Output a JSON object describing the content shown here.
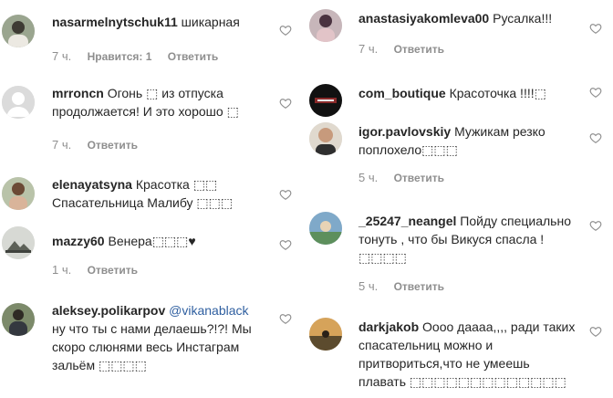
{
  "comments_left": [
    {
      "username": "nasarmelnytschuk11",
      "text": "шикарная",
      "time": "7 ч.",
      "likes": "Нравится: 1",
      "reply": "Ответить",
      "avatar_icon": "user-photo-avatar"
    },
    {
      "username": "mrroncn",
      "text": "Огонь ⬚ из отпуска продолжается! И это хорошо ⬚",
      "time": "7 ч.",
      "reply": "Ответить",
      "avatar_icon": "default-avatar-icon"
    },
    {
      "username": "elenayatsyna",
      "text": "Красотка ⬚⬚ Спасательница Малибу ⬚⬚⬚",
      "avatar_icon": "user-photo-avatar"
    },
    {
      "username": "mazzy60",
      "text": "Венера⬚⬚⬚♥",
      "time": "1 ч.",
      "reply": "Ответить",
      "avatar_icon": "user-photo-avatar"
    },
    {
      "username": "aleksey.polikarpov",
      "mention": "@vikanablack",
      "text": "ну что ты с нами делаешь?!?! Мы скоро слюнями весь Инстаграм зальём ⬚⬚⬚⬚",
      "avatar_icon": "user-photo-avatar"
    }
  ],
  "comments_right": [
    {
      "username": "anastasiyakomleva00",
      "text": "Русалка!!!",
      "time": "7 ч.",
      "reply": "Ответить",
      "avatar_icon": "user-photo-avatar"
    },
    {
      "username": "com_boutique",
      "text": "Красоточка !!!!⬚",
      "avatar_icon": "brand-logo-avatar"
    },
    {
      "username": "igor.pavlovskiy",
      "text": "Мужикам резко поплохело⬚⬚⬚",
      "time": "5 ч.",
      "reply": "Ответить",
      "avatar_icon": "user-photo-avatar"
    },
    {
      "username": "_25247_neangel",
      "text": "Пойду специально тонуть , что бы Викуся спасла ! ⬚⬚⬚⬚",
      "time": "5 ч.",
      "reply": "Ответить",
      "avatar_icon": "user-photo-avatar"
    },
    {
      "username": "darkjakob",
      "text": "Оооо даааа,,,, ради таких спасательниц можно и притвориться,что не умеешь плавать ⬚⬚⬚⬚⬚⬚⬚⬚⬚⬚⬚⬚⬚",
      "avatar_icon": "user-photo-avatar"
    }
  ],
  "colors": {
    "text": "#262626",
    "secondary": "#8e8e8e",
    "mention": "#2f5fa0",
    "heart_stroke": "#8e8e8e"
  },
  "icons": {
    "like": "heart-outline-icon"
  }
}
